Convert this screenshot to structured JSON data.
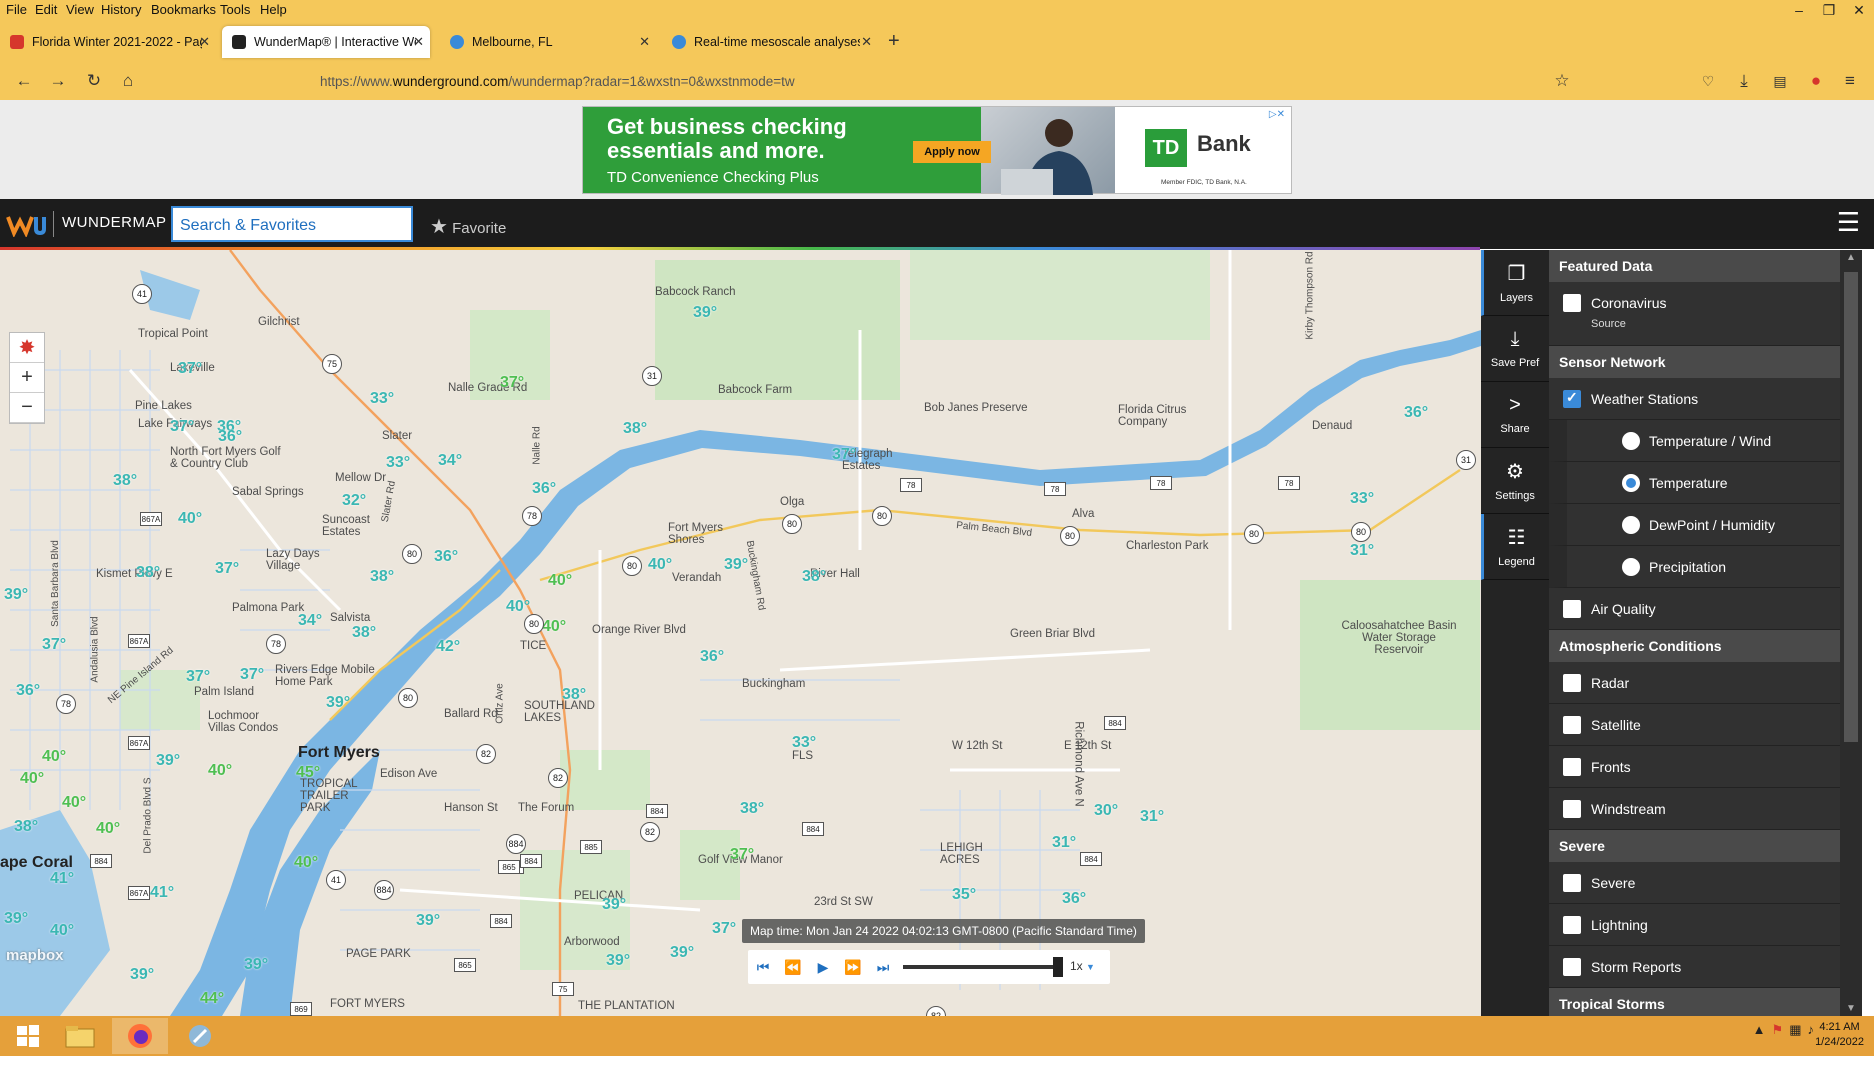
{
  "browser": {
    "menu": [
      "File",
      "Edit",
      "View",
      "History",
      "Bookmarks",
      "Tools",
      "Help"
    ],
    "tabs": [
      {
        "title": "Florida Winter 2021-2022 - Page",
        "close": "✕"
      },
      {
        "title": "WunderMap® | Interactive Wea",
        "close": "✕"
      },
      {
        "title": "Melbourne, FL",
        "close": "✕"
      },
      {
        "title": "Real-time mesoscale analyses f",
        "close": "✕"
      }
    ],
    "new_tab": "+",
    "url_prefix": "https://www.",
    "url_domain": "wunderground.com",
    "url_path": "/wundermap?radar=1&wxstn=0&wxstnmode=tw"
  },
  "ad": {
    "headline": "Get business checking essentials and more.",
    "subline": "TD Convenience Checking Plus",
    "cta": "Apply now",
    "logo": "TD",
    "brand": "Bank",
    "member": "Member FDIC, TD Bank, N.A."
  },
  "wu": {
    "name": "WUNDERMAP",
    "search_placeholder": "Search & Favorites",
    "favorite_label": "Favorite"
  },
  "map": {
    "places": [
      {
        "t": "Babcock Ranch"
      },
      {
        "t": "Tropical Point"
      },
      {
        "t": "Gilchrist"
      },
      {
        "t": "Lakeville"
      },
      {
        "t": "Pine Lakes"
      },
      {
        "t": "Lake Fairways"
      },
      {
        "t": "Nalle Grade Rd"
      },
      {
        "t": "Babcock Farm"
      },
      {
        "t": "Bob Janes Preserve"
      },
      {
        "t": "Florida Citrus Company"
      },
      {
        "t": "Denaud"
      },
      {
        "t": "Slater"
      },
      {
        "t": "North Fort Myers Golf & Country Club"
      },
      {
        "t": "Mellow Dr"
      },
      {
        "t": "Sabal Springs"
      },
      {
        "t": "Suncoast Estates"
      },
      {
        "t": "Telegraph Estates"
      },
      {
        "t": "Olga"
      },
      {
        "t": "Alva"
      },
      {
        "t": "Charleston Park"
      },
      {
        "t": "Lazy Days Village"
      },
      {
        "t": "Kismet Pkwy E"
      },
      {
        "t": "Fort Myers Shores"
      },
      {
        "t": "Verandah"
      },
      {
        "t": "River Hall"
      },
      {
        "t": "Palmona Park"
      },
      {
        "t": "Salvista"
      },
      {
        "t": "Orange River Blvd"
      },
      {
        "t": "Green Briar Blvd"
      },
      {
        "t": "Caloosahatchee Basin Water Storage Reservoir"
      },
      {
        "t": "TICE"
      },
      {
        "t": "Rivers Edge Mobile Home Park"
      },
      {
        "t": "Palm Island"
      },
      {
        "t": "Buckingham"
      },
      {
        "t": "Lochmoor Villas Condos"
      },
      {
        "t": "Ballard Rd"
      },
      {
        "t": "SOUTHLAND LAKES"
      },
      {
        "t": "W 12th St"
      },
      {
        "t": "E 12th St"
      },
      {
        "t": "Fort Myers"
      },
      {
        "t": "Edison Ave"
      },
      {
        "t": "FLS"
      },
      {
        "t": "TROPICAL TRAILER PARK"
      },
      {
        "t": "Hanson St"
      },
      {
        "t": "The Forum"
      },
      {
        "t": "Richmond Ave N"
      },
      {
        "t": "Golf View Manor"
      },
      {
        "t": "LEHIGH ACRES"
      },
      {
        "t": "ape Coral"
      },
      {
        "t": "23rd St SW"
      },
      {
        "t": "PAGE PARK"
      },
      {
        "t": "Arborwood"
      },
      {
        "t": "PELICAN"
      },
      {
        "t": "THE PLANTATION"
      },
      {
        "t": "FORT MYERS"
      },
      {
        "t": "Kirby Thompson Rd"
      },
      {
        "t": "Nalle Rd"
      },
      {
        "t": "Slater Rd"
      },
      {
        "t": "Palm Beach Blvd"
      },
      {
        "t": "Buckingham Rd"
      },
      {
        "t": "Del Prado Blvd S"
      },
      {
        "t": "Santa Barbara Blvd"
      },
      {
        "t": "Andalusia Blvd"
      },
      {
        "t": "NE Pine Island Rd"
      },
      {
        "t": "Ortiz Ave"
      }
    ],
    "temps": [
      {
        "t": "39°"
      },
      {
        "t": "37°"
      },
      {
        "t": "37°"
      },
      {
        "t": "33°"
      },
      {
        "t": "37°"
      },
      {
        "t": "36°"
      },
      {
        "t": "37°"
      },
      {
        "t": "38°"
      },
      {
        "t": "33°"
      },
      {
        "t": "34°"
      },
      {
        "t": "38°"
      },
      {
        "t": "32°"
      },
      {
        "t": "40°"
      },
      {
        "t": "36°"
      },
      {
        "t": "36°"
      },
      {
        "t": "33°"
      },
      {
        "t": "38°"
      },
      {
        "t": "37°"
      },
      {
        "t": "39°"
      },
      {
        "t": "36°"
      },
      {
        "t": "40°"
      },
      {
        "t": "40°"
      },
      {
        "t": "40°"
      },
      {
        "t": "39°"
      },
      {
        "t": "38°"
      },
      {
        "t": "34°"
      },
      {
        "t": "38°"
      },
      {
        "t": "42°"
      },
      {
        "t": "40°"
      },
      {
        "t": "37°"
      },
      {
        "t": "36°"
      },
      {
        "t": "37°"
      },
      {
        "t": "37°"
      },
      {
        "t": "39°"
      },
      {
        "t": "36°"
      },
      {
        "t": "38°"
      },
      {
        "t": "33°"
      },
      {
        "t": "31°"
      },
      {
        "t": "40°"
      },
      {
        "t": "39°"
      },
      {
        "t": "40°"
      },
      {
        "t": "45°"
      },
      {
        "t": "40°"
      },
      {
        "t": "40°"
      },
      {
        "t": "38°"
      },
      {
        "t": "41°"
      },
      {
        "t": "40°"
      },
      {
        "t": "40°"
      },
      {
        "t": "41°"
      },
      {
        "t": "39°"
      },
      {
        "t": "40°"
      },
      {
        "t": "38°"
      },
      {
        "t": "37°"
      },
      {
        "t": "39°"
      },
      {
        "t": "30°"
      },
      {
        "t": "31°"
      },
      {
        "t": "31°"
      },
      {
        "t": "35°"
      },
      {
        "t": "36°"
      },
      {
        "t": "39°"
      },
      {
        "t": "39°"
      },
      {
        "t": "39°"
      },
      {
        "t": "39°"
      },
      {
        "t": "37°"
      },
      {
        "t": "38°"
      },
      {
        "t": "44°"
      },
      {
        "t": "39°"
      },
      {
        "t": "36°"
      }
    ],
    "shields": [
      "41",
      "75",
      "31",
      "78",
      "78",
      "80",
      "80",
      "80",
      "78",
      "78",
      "80",
      "80",
      "78",
      "80",
      "31",
      "82",
      "80",
      "865",
      "82",
      "82",
      "884",
      "884",
      "884",
      "884",
      "865",
      "885",
      "884",
      "41",
      "80",
      "867A",
      "867A",
      "867A",
      "884",
      "884",
      "884",
      "869",
      "865",
      "75",
      "82",
      "80",
      "78",
      "884",
      "78",
      "867A"
    ],
    "map_time": "Map time: Mon Jan 24 2022 04:02:13 GMT-0800 (Pacific Standard Time)",
    "speed": "1x",
    "mapbox": "mapbox",
    "zoom_in": "+",
    "zoom_out": "−"
  },
  "rail": [
    {
      "label": "Layers",
      "icon": "layers-icon"
    },
    {
      "label": "Save Pref",
      "icon": "save-icon"
    },
    {
      "label": "Share",
      "icon": "share-icon"
    },
    {
      "label": "Settings",
      "icon": "gear-icon"
    },
    {
      "label": "Legend",
      "icon": "legend-icon"
    }
  ],
  "panel": {
    "featured": "Featured Data",
    "coronavirus": "Coronavirus",
    "source": "Source",
    "sensor": "Sensor Network",
    "stations": "Weather Stations",
    "temp_wind": "Temperature / Wind",
    "temperature": "Temperature",
    "dewpoint": "DewPoint / Humidity",
    "precip": "Precipitation",
    "air": "Air Quality",
    "atmo": "Atmospheric Conditions",
    "radar": "Radar",
    "satellite": "Satellite",
    "fronts": "Fronts",
    "windstream": "Windstream",
    "severe_h": "Severe",
    "severe": "Severe",
    "lightning": "Lightning",
    "storm": "Storm Reports",
    "tropical": "Tropical Storms"
  },
  "taskbar": {
    "time": "4:21 AM",
    "date": "1/24/2022"
  }
}
